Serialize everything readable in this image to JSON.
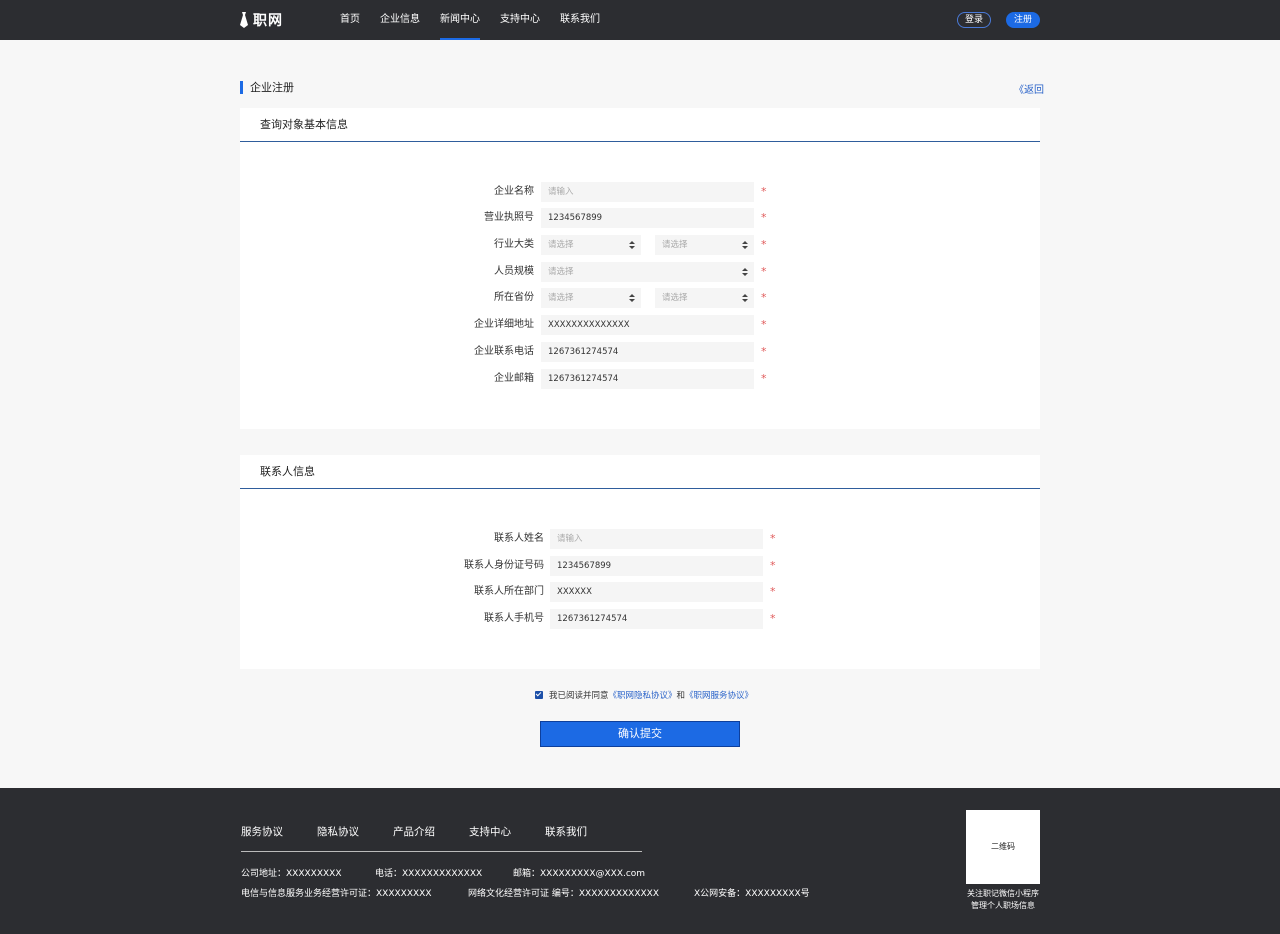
{
  "header": {
    "logo_text": "职网",
    "nav": [
      "首页",
      "企业信息",
      "新闻中心",
      "支持中心",
      "联系我们"
    ],
    "active_nav": "新闻中心",
    "login_label": "登录",
    "register_label": "注册"
  },
  "page": {
    "title": "企业注册",
    "back_label": "《返回"
  },
  "basic_info": {
    "heading": "查询对象基本信息",
    "company_name": {
      "label": "企业名称",
      "placeholder": "请输入"
    },
    "license_no": {
      "label": "营业执照号",
      "value": "1234567899"
    },
    "industry": {
      "label": "行业大类",
      "placeholder1": "请选择",
      "placeholder2": "请选择"
    },
    "staff_size": {
      "label": "人员规模",
      "placeholder": "请选择"
    },
    "province": {
      "label": "所在省份",
      "placeholder1": "请选择",
      "placeholder2": "请选择"
    },
    "address": {
      "label": "企业详细地址",
      "value": "XXXXXXXXXXXXXX"
    },
    "phone": {
      "label": "企业联系电话",
      "value": "1267361274574"
    },
    "email": {
      "label": "企业邮箱",
      "value": "1267361274574"
    },
    "required_mark": "*"
  },
  "contact_info": {
    "heading": "联系人信息",
    "name": {
      "label": "联系人姓名",
      "placeholder": "请输入"
    },
    "id_no": {
      "label": "联系人身份证号码",
      "value": "1234567899"
    },
    "department": {
      "label": "联系人所在部门",
      "value": "XXXXXX"
    },
    "mobile": {
      "label": "联系人手机号",
      "value": "1267361274574"
    },
    "required_mark": "*"
  },
  "agreement": {
    "text_prefix": "我已阅读并同意",
    "privacy_link": "《职网隐私协议》",
    "conjunction": "和",
    "service_link": "《职网服务协议》",
    "checked": true
  },
  "submit_label": "确认提交",
  "footer": {
    "links": [
      "服务协议",
      "隐私协议",
      "产品介绍",
      "支持中心",
      "联系我们"
    ],
    "address": "公司地址：XXXXXXXXX",
    "phone": "电话：XXXXXXXXXXXXX",
    "email": "邮箱：XXXXXXXXX@XXX.com",
    "telecom_license": "电信与信息服务业务经营许可证：XXXXXXXXX",
    "culture_license": "网络文化经营许可证 编号：XXXXXXXXXXXXX",
    "police_record": "X公网安备：XXXXXXXXX号",
    "qr_label": "二维码",
    "qr_caption_line1": "关注职记微信小程序",
    "qr_caption_line2": "管理个人职场信息"
  },
  "colors": {
    "header_bg": "#2c2d31",
    "accent": "#1c6ae4",
    "link": "#2a63c9",
    "required": "#e05a5a",
    "page_bg": "#f7f7f7"
  }
}
